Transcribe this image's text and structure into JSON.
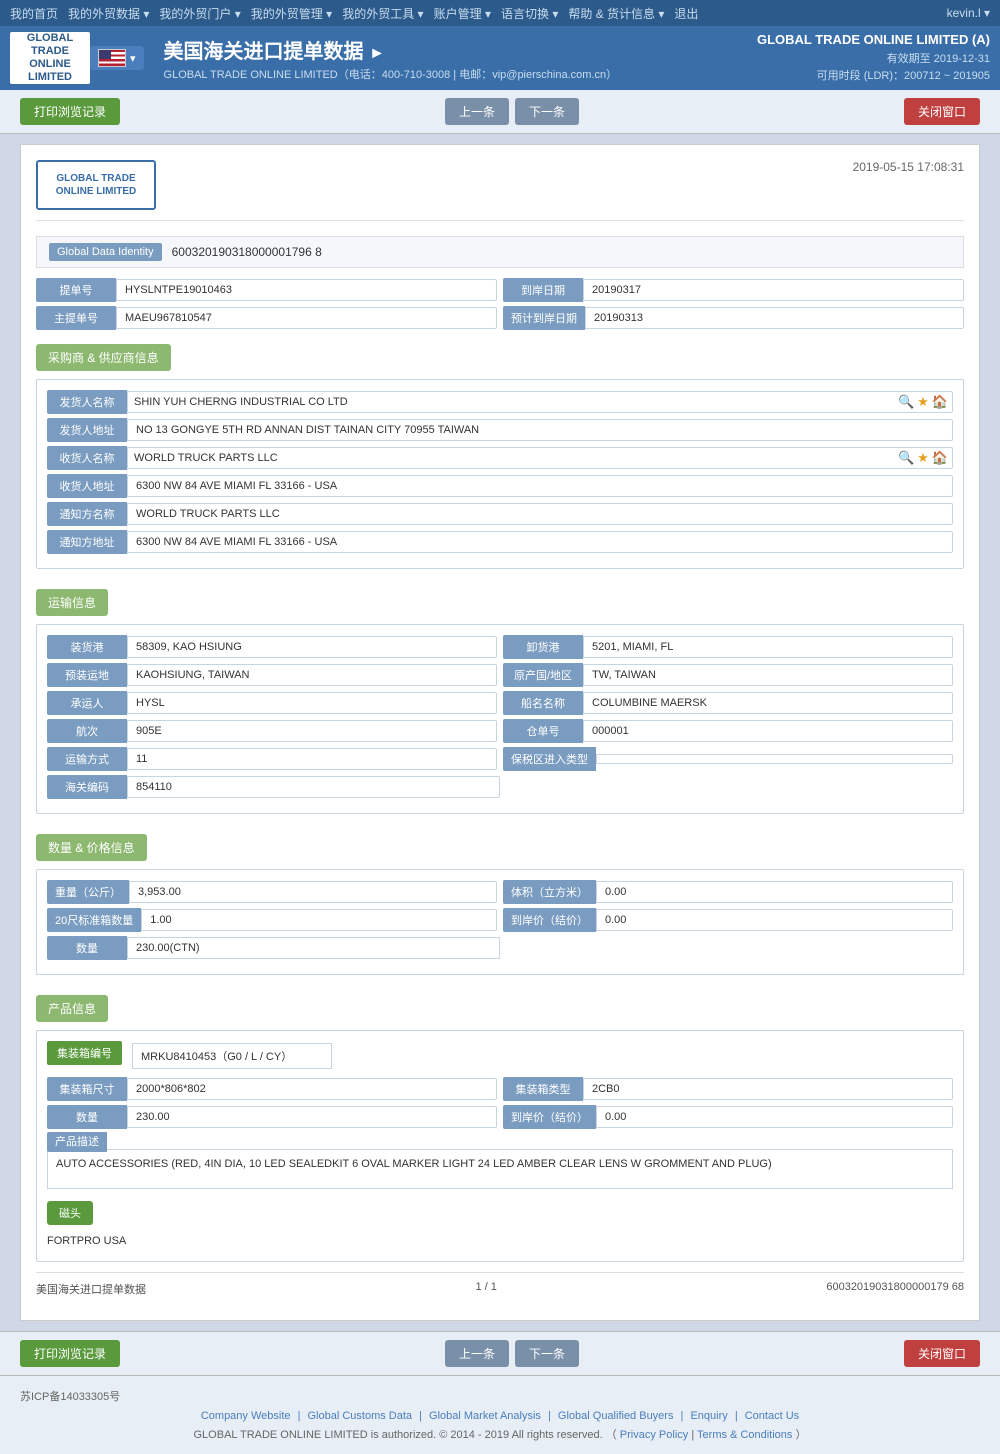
{
  "topnav": {
    "items": [
      {
        "label": "我的首页",
        "arrow": "▾"
      },
      {
        "label": "我的外贸数据",
        "arrow": "▾"
      },
      {
        "label": "我的外贸门户",
        "arrow": "▾"
      },
      {
        "label": "我的外贸管理",
        "arrow": "▾"
      },
      {
        "label": "我的外贸工具",
        "arrow": "▾"
      },
      {
        "label": "账户管理",
        "arrow": "▾"
      },
      {
        "label": "语言切换",
        "arrow": "▾"
      },
      {
        "label": "帮助 & 货计信息",
        "arrow": "▾"
      },
      {
        "label": "退出"
      }
    ],
    "username": "kevin.l ▾"
  },
  "header": {
    "logo_line1": "GLOBAL TRADE",
    "logo_line2": "ONLINE LIMITED",
    "title": "美国海关进口提单数据",
    "title_arrow": "►",
    "company_full": "GLOBAL TRADE ONLINE LIMITED（电话：400-710-3008 | 电邮：vip@pierschina.com.cn）",
    "account_company": "GLOBAL TRADE ONLINE LIMITED (A)",
    "account_expire": "有效期至 2019-12-31",
    "account_ldr": "可用时段 (LDR)：200712 ~ 201905"
  },
  "actions": {
    "print_label": "打印浏览记录",
    "prev_label": "上一条",
    "next_label": "下一条",
    "close_label": "关闭窗口"
  },
  "document": {
    "doc_logo_line1": "GLOBAL TRADE",
    "doc_logo_line2": "ONLINE LIMITED",
    "datetime": "2019-05-15 17:08:31",
    "identity_label": "Global Data Identity",
    "identity_value": "600320190318000001796 8",
    "bill_label": "提单号",
    "bill_value": "HYSLNTPE19010463",
    "arrival_date_label": "到岸日期",
    "arrival_date_value": "20190317",
    "main_bill_label": "主提单号",
    "main_bill_value": "MAEU967810547",
    "planned_date_label": "预计到岸日期",
    "planned_date_value": "20190313"
  },
  "supplier": {
    "section_label": "采购商 & 供应商信息",
    "shipper_name_label": "发货人名称",
    "shipper_name_value": "SHIN YUH CHERNG INDUSTRIAL CO LTD",
    "shipper_addr_label": "发货人地址",
    "shipper_addr_value": "NO 13 GONGYE 5TH RD ANNAN DIST TAINAN CITY 70955 TAIWAN",
    "consignee_name_label": "收货人名称",
    "consignee_name_value": "WORLD TRUCK PARTS LLC",
    "consignee_addr_label": "收货人地址",
    "consignee_addr_value": "6300 NW 84 AVE MIAMI FL 33166 - USA",
    "notify_name_label": "通知方名称",
    "notify_name_value": "WORLD TRUCK PARTS LLC",
    "notify_addr_label": "通知方地址",
    "notify_addr_value": "6300 NW 84 AVE MIAMI FL 33166 - USA"
  },
  "transport": {
    "section_label": "运输信息",
    "departure_port_label": "装货港",
    "departure_port_value": "58309, KAO HSIUNG",
    "arrival_port_label": "卸货港",
    "arrival_port_value": "5201, MIAMI, FL",
    "loading_place_label": "预装运地",
    "loading_place_value": "KAOHSIUNG, TAIWAN",
    "origin_label": "原产国/地区",
    "origin_value": "TW, TAIWAN",
    "carrier_label": "承运人",
    "carrier_value": "HYSL",
    "vessel_label": "船名名称",
    "vessel_value": "COLUMBINE MAERSK",
    "voyage_label": "航次",
    "voyage_value": "905E",
    "warehouse_label": "仓单号",
    "warehouse_value": "000001",
    "transport_mode_label": "运输方式",
    "transport_mode_value": "11",
    "tariff_zone_label": "保税区进入类型",
    "tariff_zone_value": "",
    "hs_code_label": "海关编码",
    "hs_code_value": "854110"
  },
  "quantity": {
    "section_label": "数量 & 价格信息",
    "weight_label": "重量（公斤）",
    "weight_value": "3,953.00",
    "volume_label": "体积（立方米）",
    "volume_value": "0.00",
    "container20_label": "20尺标准箱数量",
    "container20_value": "1.00",
    "shore_price_label": "到岸价（结价）",
    "shore_price_value": "0.00",
    "quantity_label": "数量",
    "quantity_value": "230.00(CTN)"
  },
  "product": {
    "section_label": "产品信息",
    "container_no_label": "集装箱编号",
    "container_no_value": "MRKU8410453（G0 / L / CY）",
    "container_size_label": "集装箱尺寸",
    "container_size_value": "2000*806*802",
    "container_type_label": "集装箱类型",
    "container_type_value": "2CB0",
    "quantity_label": "数量",
    "quantity_value": "230.00",
    "shore_price_label": "到岸价（结价）",
    "shore_price_value": "0.00",
    "desc_label": "产品描述",
    "desc_value": "AUTO ACCESSORIES (RED, 4IN DIA, 10 LED SEALEDKIT 6 OVAL MARKER LIGHT 24 LED AMBER CLEAR LENS W GROMMENT AND PLUG)",
    "brand_label": "磁头",
    "brand_value": "FORTPRO USA"
  },
  "doc_footer": {
    "title": "美国海关进口提单数据",
    "page": "1 / 1",
    "id": "60032019031800000179 68"
  },
  "page_footer": {
    "icp": "苏ICP备14033305号",
    "company_website": "Company Website",
    "global_customs": "Global Customs Data",
    "global_market": "Global Market Analysis",
    "global_qualified": "Global Qualified Buyers",
    "enquiry": "Enquiry",
    "contact_us": "Contact Us",
    "copyright": "GLOBAL TRADE ONLINE LIMITED is authorized. © 2014 - 2019 All rights reserved.  （",
    "privacy": "Privacy Policy",
    "separator": "|",
    "terms": "Terms & Conditions",
    "close_paren": "）"
  }
}
